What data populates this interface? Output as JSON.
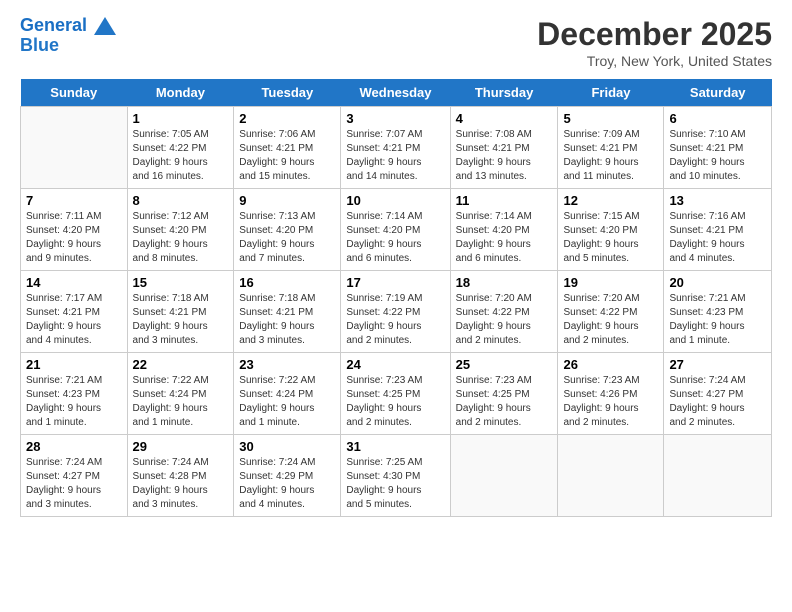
{
  "header": {
    "logo_line1": "General",
    "logo_line2": "Blue",
    "title": "December 2025",
    "subtitle": "Troy, New York, United States"
  },
  "days_of_week": [
    "Sunday",
    "Monday",
    "Tuesday",
    "Wednesday",
    "Thursday",
    "Friday",
    "Saturday"
  ],
  "weeks": [
    [
      {
        "num": "",
        "info": ""
      },
      {
        "num": "1",
        "info": "Sunrise: 7:05 AM\nSunset: 4:22 PM\nDaylight: 9 hours\nand 16 minutes."
      },
      {
        "num": "2",
        "info": "Sunrise: 7:06 AM\nSunset: 4:21 PM\nDaylight: 9 hours\nand 15 minutes."
      },
      {
        "num": "3",
        "info": "Sunrise: 7:07 AM\nSunset: 4:21 PM\nDaylight: 9 hours\nand 14 minutes."
      },
      {
        "num": "4",
        "info": "Sunrise: 7:08 AM\nSunset: 4:21 PM\nDaylight: 9 hours\nand 13 minutes."
      },
      {
        "num": "5",
        "info": "Sunrise: 7:09 AM\nSunset: 4:21 PM\nDaylight: 9 hours\nand 11 minutes."
      },
      {
        "num": "6",
        "info": "Sunrise: 7:10 AM\nSunset: 4:21 PM\nDaylight: 9 hours\nand 10 minutes."
      }
    ],
    [
      {
        "num": "7",
        "info": "Sunrise: 7:11 AM\nSunset: 4:20 PM\nDaylight: 9 hours\nand 9 minutes."
      },
      {
        "num": "8",
        "info": "Sunrise: 7:12 AM\nSunset: 4:20 PM\nDaylight: 9 hours\nand 8 minutes."
      },
      {
        "num": "9",
        "info": "Sunrise: 7:13 AM\nSunset: 4:20 PM\nDaylight: 9 hours\nand 7 minutes."
      },
      {
        "num": "10",
        "info": "Sunrise: 7:14 AM\nSunset: 4:20 PM\nDaylight: 9 hours\nand 6 minutes."
      },
      {
        "num": "11",
        "info": "Sunrise: 7:14 AM\nSunset: 4:20 PM\nDaylight: 9 hours\nand 6 minutes."
      },
      {
        "num": "12",
        "info": "Sunrise: 7:15 AM\nSunset: 4:20 PM\nDaylight: 9 hours\nand 5 minutes."
      },
      {
        "num": "13",
        "info": "Sunrise: 7:16 AM\nSunset: 4:21 PM\nDaylight: 9 hours\nand 4 minutes."
      }
    ],
    [
      {
        "num": "14",
        "info": "Sunrise: 7:17 AM\nSunset: 4:21 PM\nDaylight: 9 hours\nand 4 minutes."
      },
      {
        "num": "15",
        "info": "Sunrise: 7:18 AM\nSunset: 4:21 PM\nDaylight: 9 hours\nand 3 minutes."
      },
      {
        "num": "16",
        "info": "Sunrise: 7:18 AM\nSunset: 4:21 PM\nDaylight: 9 hours\nand 3 minutes."
      },
      {
        "num": "17",
        "info": "Sunrise: 7:19 AM\nSunset: 4:22 PM\nDaylight: 9 hours\nand 2 minutes."
      },
      {
        "num": "18",
        "info": "Sunrise: 7:20 AM\nSunset: 4:22 PM\nDaylight: 9 hours\nand 2 minutes."
      },
      {
        "num": "19",
        "info": "Sunrise: 7:20 AM\nSunset: 4:22 PM\nDaylight: 9 hours\nand 2 minutes."
      },
      {
        "num": "20",
        "info": "Sunrise: 7:21 AM\nSunset: 4:23 PM\nDaylight: 9 hours\nand 1 minute."
      }
    ],
    [
      {
        "num": "21",
        "info": "Sunrise: 7:21 AM\nSunset: 4:23 PM\nDaylight: 9 hours\nand 1 minute."
      },
      {
        "num": "22",
        "info": "Sunrise: 7:22 AM\nSunset: 4:24 PM\nDaylight: 9 hours\nand 1 minute."
      },
      {
        "num": "23",
        "info": "Sunrise: 7:22 AM\nSunset: 4:24 PM\nDaylight: 9 hours\nand 1 minute."
      },
      {
        "num": "24",
        "info": "Sunrise: 7:23 AM\nSunset: 4:25 PM\nDaylight: 9 hours\nand 2 minutes."
      },
      {
        "num": "25",
        "info": "Sunrise: 7:23 AM\nSunset: 4:25 PM\nDaylight: 9 hours\nand 2 minutes."
      },
      {
        "num": "26",
        "info": "Sunrise: 7:23 AM\nSunset: 4:26 PM\nDaylight: 9 hours\nand 2 minutes."
      },
      {
        "num": "27",
        "info": "Sunrise: 7:24 AM\nSunset: 4:27 PM\nDaylight: 9 hours\nand 2 minutes."
      }
    ],
    [
      {
        "num": "28",
        "info": "Sunrise: 7:24 AM\nSunset: 4:27 PM\nDaylight: 9 hours\nand 3 minutes."
      },
      {
        "num": "29",
        "info": "Sunrise: 7:24 AM\nSunset: 4:28 PM\nDaylight: 9 hours\nand 3 minutes."
      },
      {
        "num": "30",
        "info": "Sunrise: 7:24 AM\nSunset: 4:29 PM\nDaylight: 9 hours\nand 4 minutes."
      },
      {
        "num": "31",
        "info": "Sunrise: 7:25 AM\nSunset: 4:30 PM\nDaylight: 9 hours\nand 5 minutes."
      },
      {
        "num": "",
        "info": ""
      },
      {
        "num": "",
        "info": ""
      },
      {
        "num": "",
        "info": ""
      }
    ]
  ]
}
